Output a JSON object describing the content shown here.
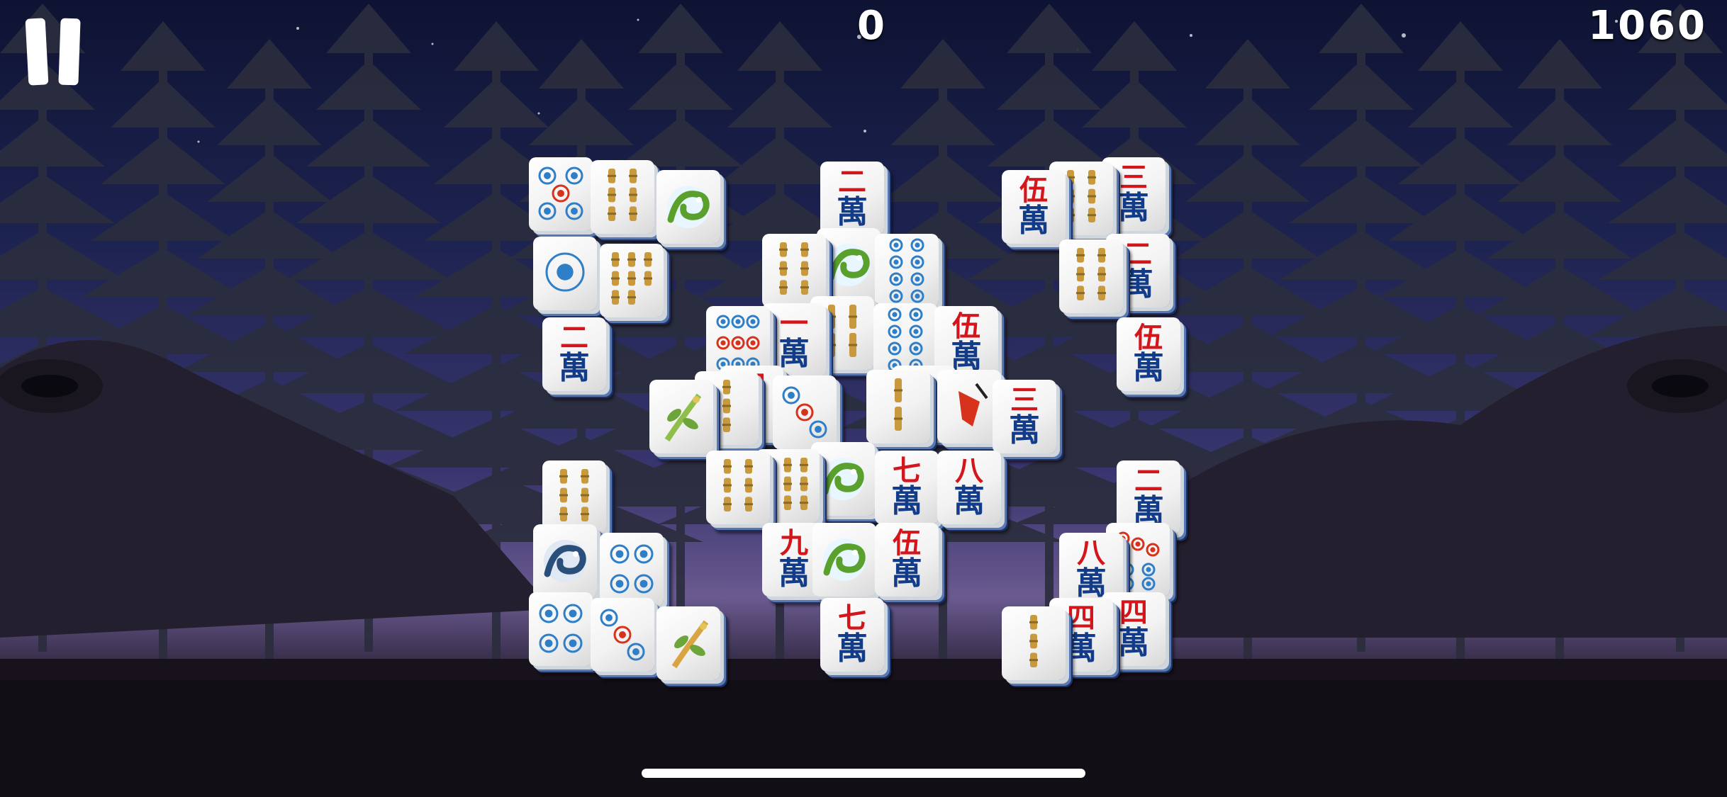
{
  "hud": {
    "current_score": "0",
    "target_score": "1060"
  },
  "tiles": [
    {
      "kind": "circle",
      "n": 5
    },
    {
      "kind": "bamboo",
      "n": 6
    },
    {
      "kind": "dragon",
      "color": "green"
    },
    {
      "kind": "circle",
      "n": 1
    },
    {
      "kind": "bamboo",
      "n": 8
    },
    {
      "kind": "char",
      "num": "二"
    },
    {
      "kind": "char",
      "num": "二"
    },
    {
      "kind": "bamboo",
      "n": 6
    },
    {
      "kind": "dragon",
      "color": "green"
    },
    {
      "kind": "circle",
      "n": 8
    },
    {
      "kind": "circle",
      "n": 9
    },
    {
      "kind": "char",
      "num": "一"
    },
    {
      "kind": "bamboo",
      "n": 4
    },
    {
      "kind": "circle",
      "n": 8
    },
    {
      "kind": "char",
      "num": "伍"
    },
    {
      "kind": "flower",
      "color": "green"
    },
    {
      "kind": "bamboo",
      "n": 3
    },
    {
      "kind": "char",
      "num": "四"
    },
    {
      "kind": "circle",
      "n": 3
    },
    {
      "kind": "bamboo",
      "n": 2
    },
    {
      "kind": "char",
      "num": "九"
    },
    {
      "kind": "season",
      "color": "red"
    },
    {
      "kind": "char",
      "num": "三"
    },
    {
      "kind": "bamboo",
      "n": 6
    },
    {
      "kind": "bamboo",
      "n": 9
    },
    {
      "kind": "dragon",
      "color": "green"
    },
    {
      "kind": "char",
      "num": "七"
    },
    {
      "kind": "char",
      "num": "八"
    },
    {
      "kind": "char",
      "num": "九"
    },
    {
      "kind": "dragon",
      "color": "green"
    },
    {
      "kind": "char",
      "num": "伍"
    },
    {
      "kind": "char",
      "num": "七"
    },
    {
      "kind": "char",
      "num": "伍"
    },
    {
      "kind": "bamboo",
      "n": 6
    },
    {
      "kind": "char",
      "num": "三"
    },
    {
      "kind": "bamboo",
      "n": 6
    },
    {
      "kind": "char",
      "num": "二"
    },
    {
      "kind": "char",
      "num": "伍"
    },
    {
      "kind": "bamboo",
      "n": 6
    },
    {
      "kind": "dragon",
      "color": "blue"
    },
    {
      "kind": "circle",
      "n": 4
    },
    {
      "kind": "circle",
      "n": 4
    },
    {
      "kind": "circle",
      "n": 3
    },
    {
      "kind": "flower",
      "color": "yellow"
    },
    {
      "kind": "char",
      "num": "二"
    },
    {
      "kind": "char",
      "num": "八"
    },
    {
      "kind": "circle",
      "n": 7
    },
    {
      "kind": "bamboo",
      "n": 3
    },
    {
      "kind": "char",
      "num": "四"
    },
    {
      "kind": "char",
      "num": "四"
    }
  ],
  "wan_glyph": "萬",
  "colors": {
    "char_red": "#d2161c",
    "char_blue": "#123c8a",
    "circle_blue": "#2f7fc8",
    "circle_red": "#d7321c",
    "bamboo": "#c99a3d",
    "dragon_green": "#5aa02c"
  }
}
